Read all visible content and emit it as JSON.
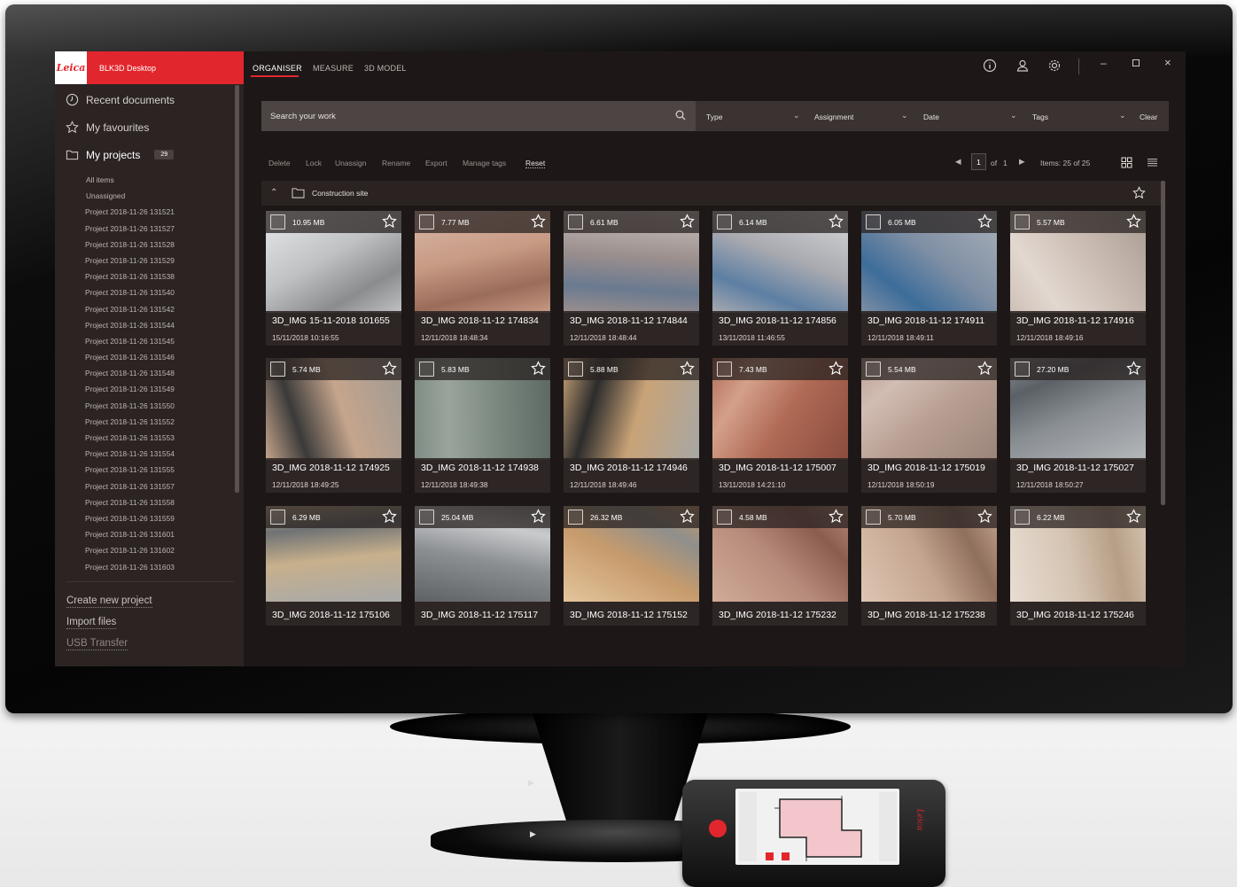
{
  "app": {
    "logo": "Leica",
    "title": "BLK3D Desktop"
  },
  "tabs": [
    {
      "label": "ORGANISER",
      "active": true
    },
    {
      "label": "MEASURE",
      "active": false
    },
    {
      "label": "3D MODEL",
      "active": false
    }
  ],
  "sidebar": {
    "recent": "Recent documents",
    "favourites": "My favourites",
    "projects": "My projects",
    "projects_count": "29",
    "subitems": [
      "All items",
      "Unassigned"
    ],
    "projects_list": [
      "Project 2018-11-26 131521",
      "Project 2018-11-26 131527",
      "Project 2018-11-26 131528",
      "Project 2018-11-26 131529",
      "Project 2018-11-26 131538",
      "Project 2018-11-26 131540",
      "Project 2018-11-26 131542",
      "Project 2018-11-26 131544",
      "Project 2018-11-26 131545",
      "Project 2018-11-26 131546",
      "Project 2018-11-26 131548",
      "Project 2018-11-26 131549",
      "Project 2018-11-26 131550",
      "Project 2018-11-26 131552",
      "Project 2018-11-26 131553",
      "Project 2018-11-26 131554",
      "Project 2018-11-26 131555",
      "Project 2018-11-26 131557",
      "Project 2018-11-26 131558",
      "Project 2018-11-26 131559",
      "Project 2018-11-26 131601",
      "Project 2018-11-26 131602",
      "Project 2018-11-26 131603"
    ],
    "actions": [
      "Create new project",
      "Import files",
      "USB Transfer"
    ]
  },
  "search": {
    "placeholder": "Search your work",
    "filters": [
      "Type",
      "Assignment",
      "Date",
      "Tags"
    ],
    "clear": "Clear"
  },
  "toolbar": {
    "actions": [
      "Delete",
      "Lock",
      "Unassign",
      "Rename",
      "Export",
      "Manage tags"
    ],
    "reset": "Reset",
    "page": "1",
    "of": "of",
    "total_pages": "1",
    "items": "Items: 25 of 25"
  },
  "group": {
    "name": "Construction site"
  },
  "items": [
    {
      "size": "10.95 MB",
      "name": "3D_IMG 15-11-2018 101655",
      "date": "15/11/2018 10:16:55",
      "palette": [
        "#bfc1c2",
        "#8a8c8d",
        "#e8eaeb"
      ]
    },
    {
      "size": "7.77 MB",
      "name": "3D_IMG 2018-11-12 174834",
      "date": "12/11/2018 18:48:34",
      "palette": [
        "#c79a84",
        "#9a6c5a",
        "#d9b9a8"
      ]
    },
    {
      "size": "6.61 MB",
      "name": "3D_IMG 2018-11-12 174844",
      "date": "12/11/2018 18:48:44",
      "palette": [
        "#9b8f8d",
        "#6a7a90",
        "#c9c2bd"
      ]
    },
    {
      "size": "6.14 MB",
      "name": "3D_IMG 2018-11-12 174856",
      "date": "13/11/2018 11:46:55",
      "palette": [
        "#a9aab0",
        "#5d7fa3",
        "#d8d8da"
      ]
    },
    {
      "size": "6.05 MB",
      "name": "3D_IMG 2018-11-12 174911",
      "date": "12/11/2018 18:49:11",
      "palette": [
        "#7f8fa4",
        "#3d6d9a",
        "#a9b1b9"
      ]
    },
    {
      "size": "5.57 MB",
      "name": "3D_IMG 2018-11-12 174916",
      "date": "12/11/2018 18:49:16",
      "palette": [
        "#cdbfb6",
        "#e2d8d0",
        "#a89b92"
      ]
    },
    {
      "size": "5.74 MB",
      "name": "3D_IMG 2018-11-12 174925",
      "date": "12/11/2018 18:49:25",
      "palette": [
        "#c5a58c",
        "#3a3a3a",
        "#9f9a94"
      ]
    },
    {
      "size": "5.83 MB",
      "name": "3D_IMG 2018-11-12 174938",
      "date": "12/11/2018 18:49:38",
      "palette": [
        "#7f8c84",
        "#9aa49d",
        "#5d6a63"
      ]
    },
    {
      "size": "5.88 MB",
      "name": "3D_IMG 2018-11-12 174946",
      "date": "12/11/2018 18:49:46",
      "palette": [
        "#c9a377",
        "#2c2c2c",
        "#a7a7a5"
      ]
    },
    {
      "size": "7.43 MB",
      "name": "3D_IMG 2018-11-12 175007",
      "date": "13/11/2018 14:21:10",
      "palette": [
        "#b06a55",
        "#d4a08a",
        "#8a4c3e"
      ]
    },
    {
      "size": "5.54 MB",
      "name": "3D_IMG 2018-11-12 175019",
      "date": "12/11/2018 18:50:19",
      "palette": [
        "#b89f93",
        "#d2bdb3",
        "#9a8479"
      ]
    },
    {
      "size": "27.20 MB",
      "name": "3D_IMG 2018-11-12 175027",
      "date": "12/11/2018 18:50:27",
      "palette": [
        "#8a8f94",
        "#5b6066",
        "#b4b7ba"
      ]
    },
    {
      "size": "6.29 MB",
      "name": "3D_IMG 2018-11-12 175106",
      "date": "",
      "palette": [
        "#c7b08c",
        "#6f7275",
        "#a8a9a9"
      ]
    },
    {
      "size": "25.04 MB",
      "name": "3D_IMG 2018-11-12 175117",
      "date": "",
      "palette": [
        "#8d9093",
        "#c9cbcd",
        "#5e6164"
      ]
    },
    {
      "size": "26.32 MB",
      "name": "3D_IMG 2018-11-12 175152",
      "date": "",
      "palette": [
        "#c79b6c",
        "#8f8f8c",
        "#e3c59c"
      ]
    },
    {
      "size": "4.58 MB",
      "name": "3D_IMG 2018-11-12 175232",
      "date": "",
      "palette": [
        "#b68a7a",
        "#8b5d4f",
        "#d1aa98"
      ]
    },
    {
      "size": "5.70 MB",
      "name": "3D_IMG 2018-11-12 175238",
      "date": "",
      "palette": [
        "#c4a58f",
        "#8f6f5d",
        "#ddc5b3"
      ]
    },
    {
      "size": "6.22 MB",
      "name": "3D_IMG 2018-11-12 175246",
      "date": "",
      "palette": [
        "#d4c3b1",
        "#b79e86",
        "#e8ddd2"
      ]
    }
  ],
  "colors": {
    "accent": "#e2262d",
    "background": "#1d1817",
    "sidebar": "#2b2423"
  },
  "phone": {
    "brand": "Leica"
  }
}
